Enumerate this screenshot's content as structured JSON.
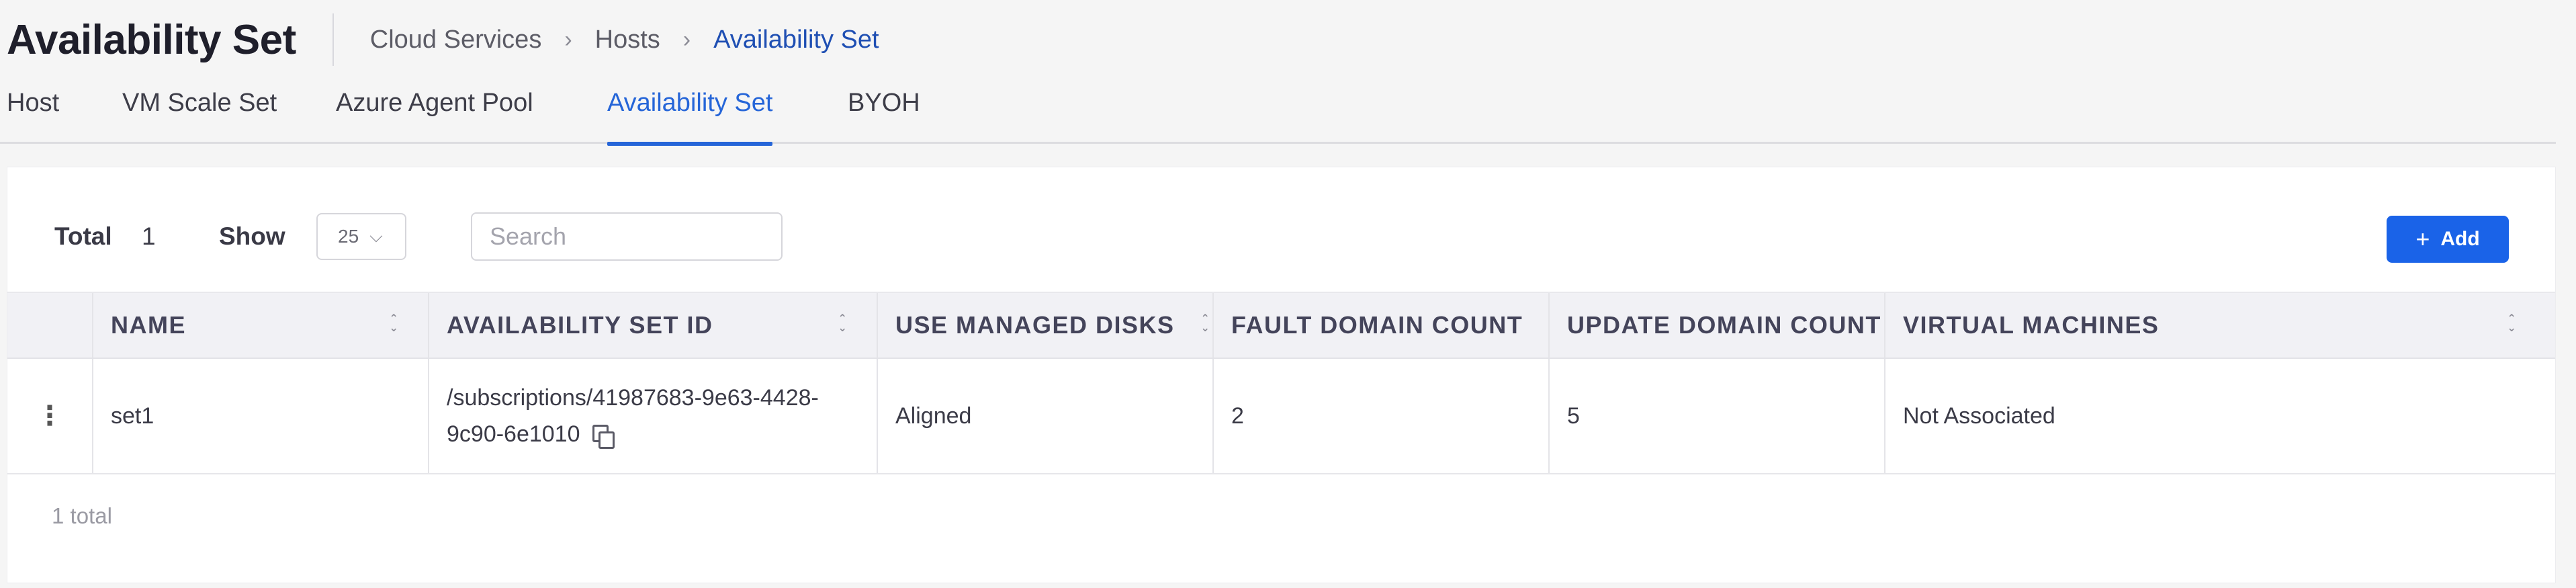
{
  "header": {
    "title": "Availability Set",
    "breadcrumb": [
      "Cloud Services",
      "Hosts",
      "Availability Set"
    ],
    "breadcrumb_separator": ">"
  },
  "tabs": [
    {
      "label": "Host",
      "active": false
    },
    {
      "label": "VM Scale Set",
      "active": false
    },
    {
      "label": "Azure Agent Pool",
      "active": false
    },
    {
      "label": "Availability Set",
      "active": true
    },
    {
      "label": "BYOH",
      "active": false
    }
  ],
  "toolbar": {
    "total_label": "Total",
    "total_count": "1",
    "show_label": "Show",
    "page_size": "25",
    "search_placeholder": "Search",
    "search_value": "",
    "add_label": "Add"
  },
  "table": {
    "columns": [
      {
        "key": "actions",
        "label": ""
      },
      {
        "key": "name",
        "label": "NAME"
      },
      {
        "key": "availability_set_id",
        "label": "AVAILABILITY SET ID"
      },
      {
        "key": "use_managed_disks",
        "label": "USE MANAGED DISKS"
      },
      {
        "key": "fault_domain_count",
        "label": "FAULT DOMAIN COUNT"
      },
      {
        "key": "update_domain_count",
        "label": "UPDATE DOMAIN COUNT"
      },
      {
        "key": "virtual_machines",
        "label": "VIRTUAL MACHINES"
      }
    ],
    "rows": [
      {
        "name": "set1",
        "availability_set_id": "/subscriptions/41987683-9e63-4428-9c90-6e1010",
        "use_managed_disks": "Aligned",
        "fault_domain_count": "2",
        "update_domain_count": "5",
        "virtual_machines": "Not Associated"
      }
    ],
    "footer": "1 total"
  },
  "colors": {
    "accent": "#2565d8",
    "button": "#1a63e8",
    "breadcrumb_active": "#1f4fb3",
    "header_bg": "#f1f1f5"
  }
}
